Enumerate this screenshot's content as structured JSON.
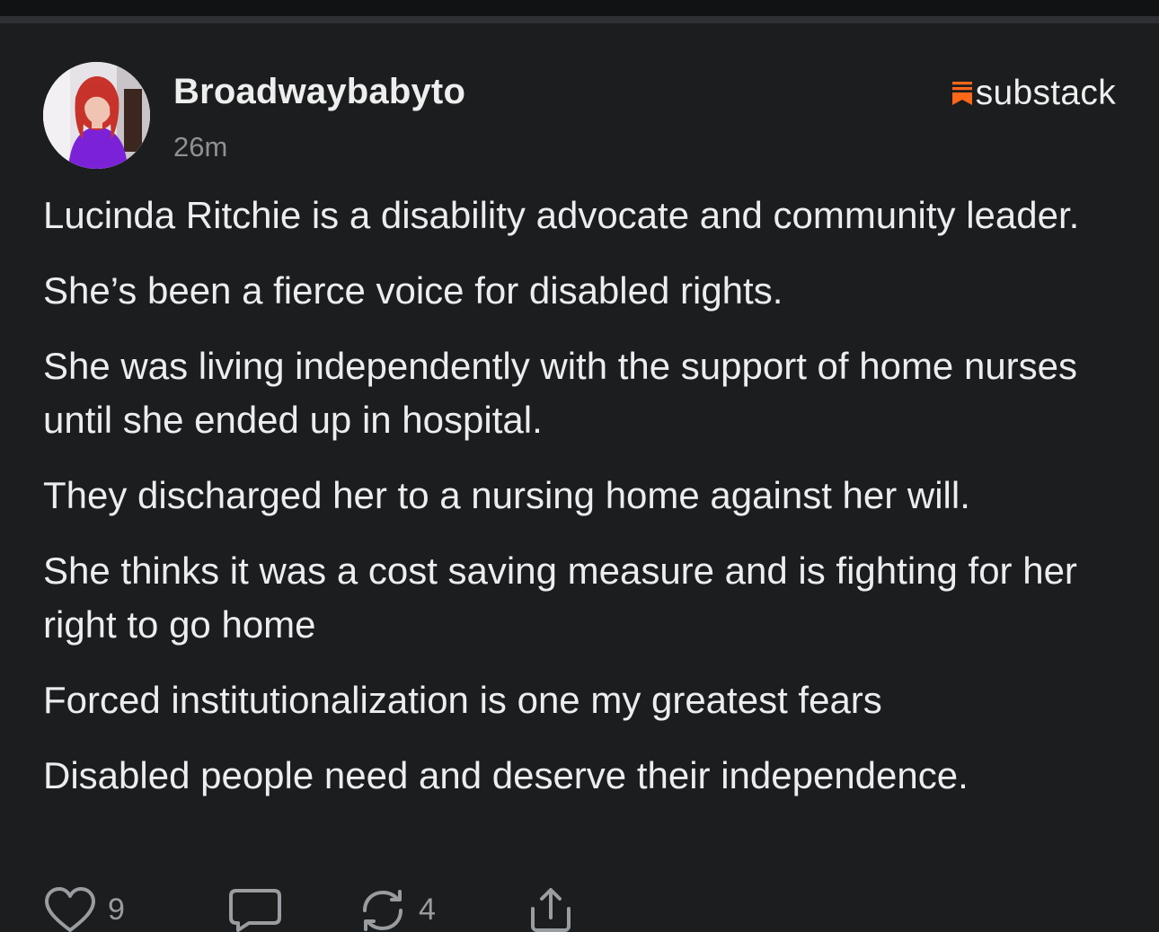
{
  "post": {
    "author": "Broadwaybabyto",
    "time": "26m",
    "brand": "substack",
    "paragraphs": [
      "Lucinda Ritchie is a disability advocate and community leader.",
      "She’s been a fierce voice for disabled rights.",
      "She was living independently with the support of home nurses until she ended up in hospital.",
      "They discharged her to a nursing home against her will.",
      "She thinks it was a cost saving measure and is fighting for her right to go home",
      "Forced institutionalization is one my greatest fears",
      "Disabled people need and deserve their independence."
    ]
  },
  "actions": {
    "likes": "9",
    "restacks": "4"
  },
  "icons": {
    "like": "heart-icon",
    "comment": "comment-bubble-icon",
    "restack": "restack-arrows-icon",
    "share": "share-icon",
    "brand": "substack-logo-icon"
  },
  "colors": {
    "background": "#1b1d1f",
    "text": "#ecedee",
    "muted": "#8e9193",
    "brand_accent": "#ff6719"
  }
}
